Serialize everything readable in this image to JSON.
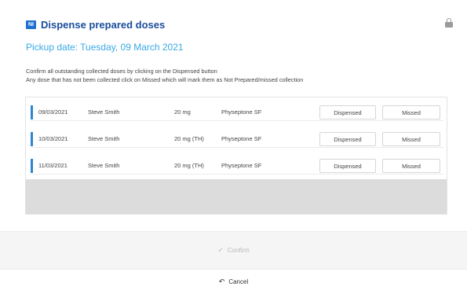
{
  "dialog": {
    "app_icon_text": "NI",
    "title": "Dispense prepared doses",
    "pickup_date": "Pickup date: Tuesday, 09 March 2021",
    "instructions": [
      "Confirm all outstanding collected doses by clicking on the Dispensed button",
      "Any dose that has not been collected click on Missed which will mark them as Not Prepared/missed collection"
    ]
  },
  "doses": [
    {
      "date": "09/03/2021",
      "name": "Steve Smith",
      "dose": "20 mg",
      "drug": "Physeptone SF",
      "dispensed_label": "Dispensed",
      "missed_label": "Missed"
    },
    {
      "date": "10/03/2021",
      "name": "Steve Smith",
      "dose": "20 mg (TH)",
      "drug": "Physeptone SF",
      "dispensed_label": "Dispensed",
      "missed_label": "Missed"
    },
    {
      "date": "11/03/2021",
      "name": "Steve Smith",
      "dose": "20 mg (TH)",
      "drug": "Physeptone SF",
      "dispensed_label": "Dispensed",
      "missed_label": "Missed"
    }
  ],
  "footer": {
    "confirm_label": "Confirm",
    "cancel_label": "Cancel"
  },
  "icons": {
    "header": "app-logo-icon",
    "lock": "lock-icon",
    "confirm": "check-icon",
    "cancel": "undo-icon"
  },
  "colors": {
    "title": "#1a4d9c",
    "pickup": "#39a9e6",
    "row_marker": "#2b86d2",
    "disabled_text": "#b9b9b9"
  }
}
